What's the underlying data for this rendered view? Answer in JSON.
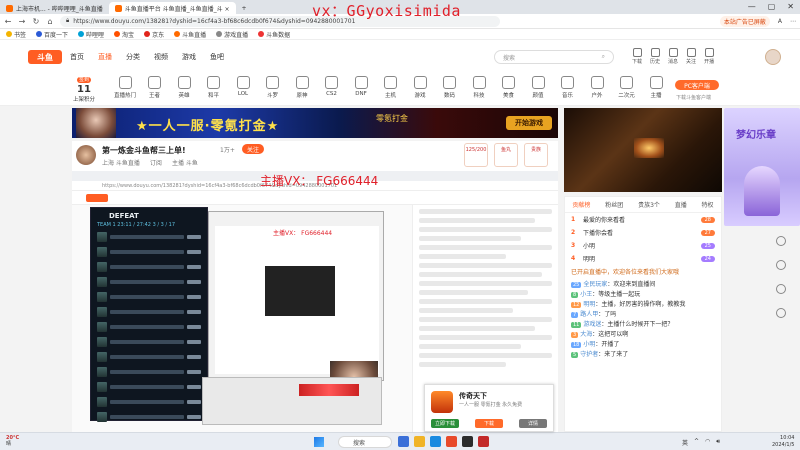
{
  "watermarks": {
    "top": "vx：GGyoxisimida",
    "stream": "主播VX： FG666444"
  },
  "browser": {
    "tabs": [
      {
        "label": "上海市机... - 哔哔哩哩_斗鱼直播"
      },
      {
        "label": "斗鱼直播平台 斗鱼直播_斗鱼直播_斗 ×"
      }
    ],
    "url": "https://www.douyu.com/138281?dyshid=16cf4a3-bf68c6dcdb0f674&dyshid=0942880001701",
    "address_right": [
      "本站广告已屏蔽",
      "A",
      "⋯"
    ],
    "bookmarks": [
      "书签",
      "百度一下",
      "哔哩哩",
      "淘宝",
      "京东",
      "斗鱼直播",
      "游戏直播",
      "斗鱼数据"
    ]
  },
  "site": {
    "logo": "斗鱼",
    "menu": [
      "首页",
      "直播",
      "分类",
      "视频",
      "游戏",
      "鱼吧"
    ],
    "search_placeholder": "搜索",
    "header_icons": [
      "下载",
      "历史",
      "消息",
      "关注",
      "开播"
    ],
    "checkin_badge": "签到",
    "checkin_num": "11",
    "checkin_label": "上架积分",
    "categories": [
      "直播热门",
      "王者",
      "英雄",
      "和平",
      "LOL",
      "斗罗",
      "原神",
      "CS2",
      "DNF",
      "主机",
      "游戏",
      "数码",
      "科技",
      "美食",
      "颜值",
      "音乐",
      "户外",
      "二次元",
      "主播"
    ],
    "pc_button": "PC客户端",
    "pc_sub": "下载斗鱼客户端"
  },
  "banner": {
    "slogan": "★一人一服·零氪打金★",
    "subtitle": "零氪打金",
    "button": "开始游戏"
  },
  "stream": {
    "title": "第一炼金斗鱼帮三上单!",
    "followers": "1万+",
    "follow_button": "关注",
    "meta": [
      "上海 斗鱼直播",
      "订阅",
      "主播 斗鱼"
    ],
    "boxes": [
      "125/200",
      "鱼丸",
      "贵族"
    ]
  },
  "defeat": {
    "title": "DEFEAT",
    "team": "TEAM 1  23:11 / 27:42  3 / 3 / 17",
    "rows": [
      "",
      "",
      "",
      "",
      "",
      "",
      "",
      "",
      "",
      "",
      "",
      "",
      ""
    ]
  },
  "right_panel": {
    "ad_title": "梦幻乐章",
    "tabs": [
      "贡献榜",
      "粉丝团",
      "贵族3个",
      "直播",
      "特权"
    ],
    "notice": "已开启直播中，欢迎各位来看我们大家哦",
    "ranks": [
      {
        "n": "1",
        "name": "最爱的你来看看",
        "badge": "28"
      },
      {
        "n": "2",
        "name": "下播你会看",
        "badge": "27"
      },
      {
        "n": "3",
        "name": "小明",
        "badge": "25"
      },
      {
        "n": "4",
        "name": "明明",
        "badge": "24"
      }
    ],
    "chat": [
      {
        "lv": "25",
        "name": "全民玩家",
        "text": "欢迎来到直播间"
      },
      {
        "lv": "8",
        "name": "小王",
        "text": "等级主播一起玩"
      },
      {
        "lv": "12",
        "name": "明明",
        "text": "主播，好厉害的操作啊，教教我"
      },
      {
        "lv": "7",
        "name": "路人甲",
        "text": "了吗"
      },
      {
        "lv": "11",
        "name": "游戏迷",
        "text": "主播什么时候开下一把？"
      },
      {
        "lv": "3",
        "name": "大海",
        "text": "这把可以啊"
      },
      {
        "lv": "18",
        "name": "小明",
        "text": "开播了"
      },
      {
        "lv": "5",
        "name": "守护者",
        "text": "来了来了"
      }
    ]
  },
  "ad_popup": {
    "title": "传奇天下",
    "sub": "一人一服 零氪打金 永久免费",
    "buttons": [
      "立即下载",
      "下载",
      "详情"
    ]
  },
  "taskbar": {
    "weather_temp": "20°C",
    "weather_text": "晴",
    "search": "搜索",
    "time": "10:04",
    "date": "2024/1/5",
    "tray": [
      "英",
      "^"
    ]
  }
}
